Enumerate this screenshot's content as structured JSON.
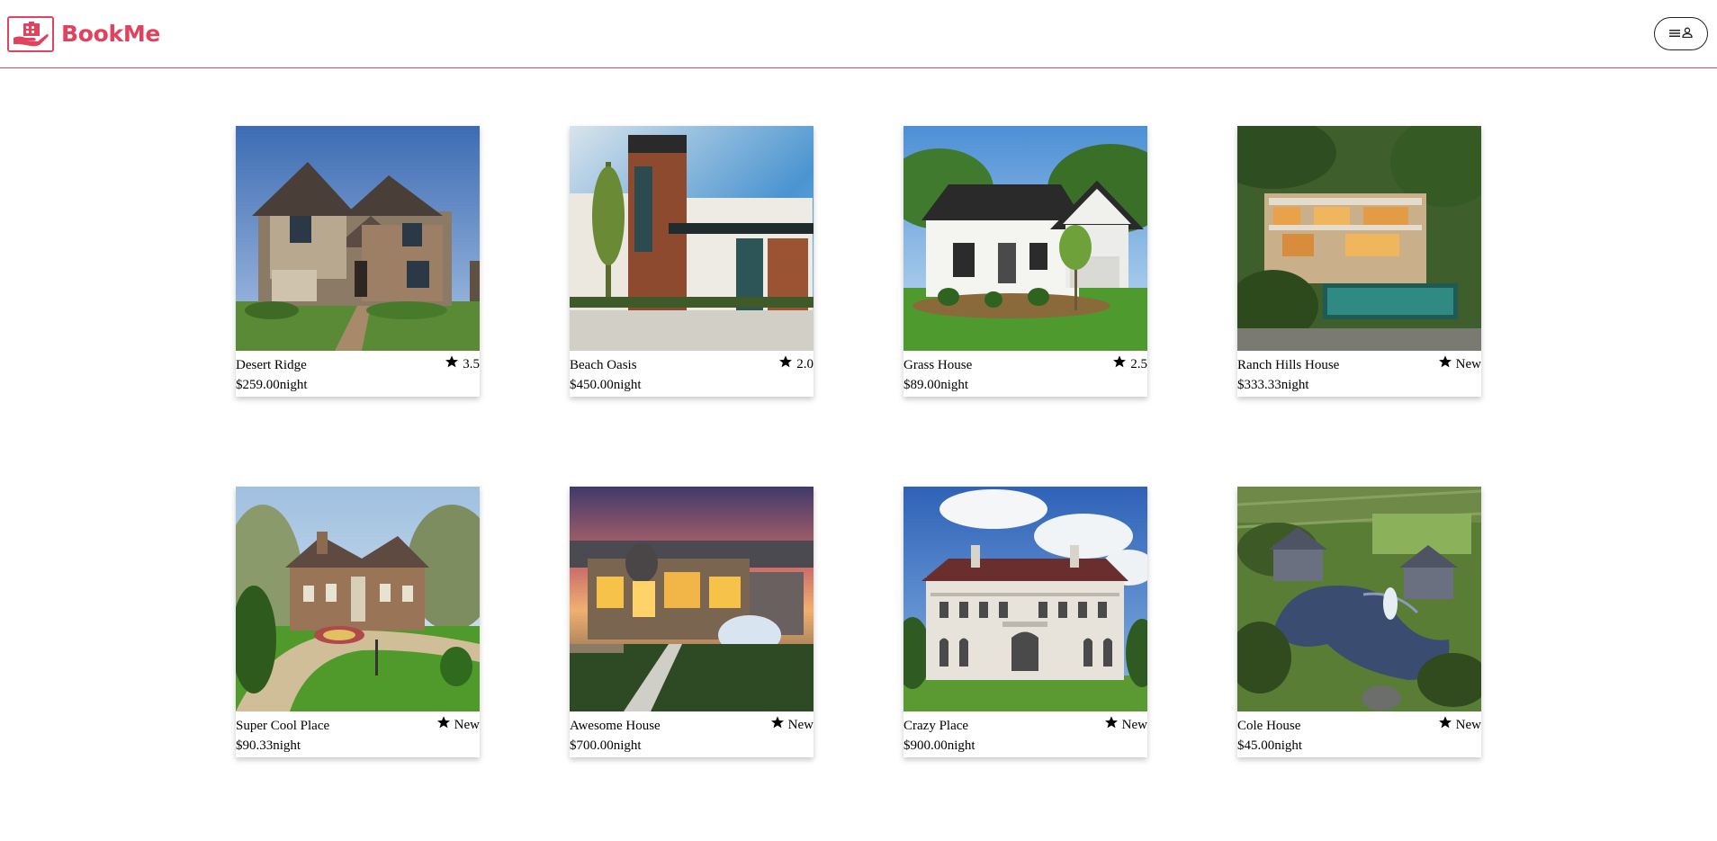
{
  "brand": {
    "name": "BookMe",
    "color": "#e0435e",
    "logo_icon": "house-hand-logo-icon"
  },
  "header": {
    "menu_icon": "hamburger-menu-icon",
    "user_icon": "user-icon"
  },
  "listings": [
    {
      "name": "Desert Ridge",
      "rating": "3.5",
      "price": "$259.00",
      "unit": "night"
    },
    {
      "name": "Beach Oasis",
      "rating": "2.0",
      "price": "$450.00",
      "unit": "night"
    },
    {
      "name": "Grass House",
      "rating": "2.5",
      "price": "$89.00",
      "unit": "night"
    },
    {
      "name": "Ranch Hills House",
      "rating": "New",
      "price": "$333.33",
      "unit": "night"
    },
    {
      "name": "Super Cool Place",
      "rating": "New",
      "price": "$90.33",
      "unit": "night"
    },
    {
      "name": "Awesome House",
      "rating": "New",
      "price": "$700.00",
      "unit": "night"
    },
    {
      "name": "Crazy Place",
      "rating": "New",
      "price": "$900.00",
      "unit": "night"
    },
    {
      "name": "Cole House",
      "rating": "New",
      "price": "$45.00",
      "unit": "night"
    }
  ]
}
